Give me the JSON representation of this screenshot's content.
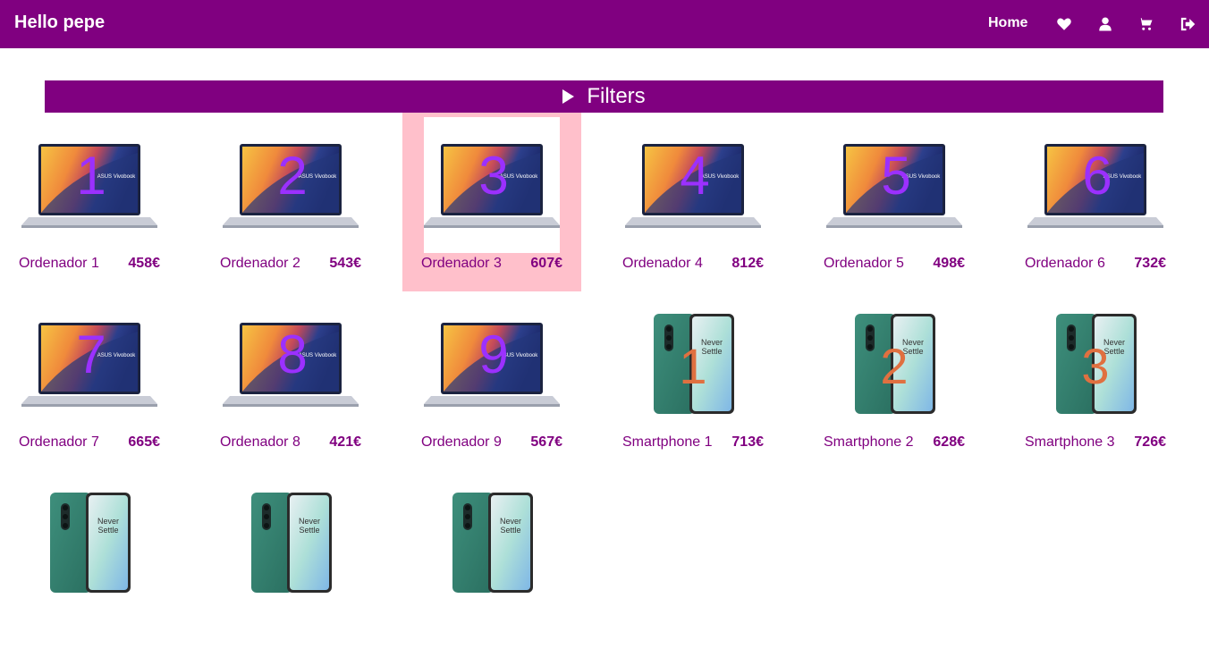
{
  "header": {
    "title": "Hello pepe",
    "home_label": "Home",
    "icons": [
      "heart-icon",
      "user-icon",
      "cart-icon",
      "logout-icon"
    ]
  },
  "filters": {
    "label": "Filters"
  },
  "products": [
    {
      "name": "Ordenador 1",
      "price": "458€",
      "badge": "1",
      "kind": "laptop"
    },
    {
      "name": "Ordenador 2",
      "price": "543€",
      "badge": "2",
      "kind": "laptop"
    },
    {
      "name": "Ordenador 3",
      "price": "607€",
      "badge": "3",
      "kind": "laptop"
    },
    {
      "name": "Ordenador 4",
      "price": "812€",
      "badge": "4",
      "kind": "laptop"
    },
    {
      "name": "Ordenador 5",
      "price": "498€",
      "badge": "5",
      "kind": "laptop"
    },
    {
      "name": "Ordenador 6",
      "price": "732€",
      "badge": "6",
      "kind": "laptop"
    },
    {
      "name": "Ordenador 7",
      "price": "665€",
      "badge": "7",
      "kind": "laptop"
    },
    {
      "name": "Ordenador 8",
      "price": "421€",
      "badge": "8",
      "kind": "laptop"
    },
    {
      "name": "Ordenador 9",
      "price": "567€",
      "badge": "9",
      "kind": "laptop"
    },
    {
      "name": "Smartphone 1",
      "price": "713€",
      "badge": "1",
      "kind": "phone"
    },
    {
      "name": "Smartphone 2",
      "price": "628€",
      "badge": "2",
      "kind": "phone"
    },
    {
      "name": "Smartphone 3",
      "price": "726€",
      "badge": "3",
      "kind": "phone"
    },
    {
      "name": "",
      "price": "",
      "badge": "",
      "kind": "phone"
    },
    {
      "name": "",
      "price": "",
      "badge": "",
      "kind": "phone"
    },
    {
      "name": "",
      "price": "",
      "badge": "",
      "kind": "phone"
    }
  ],
  "laptop_brand_text": "ASUS Vivobook",
  "phone_text": [
    "Never",
    "Settle"
  ],
  "colors": {
    "brand": "#800080",
    "highlight": "#ffc0cb",
    "laptop_badge": "#9b30ff",
    "phone_badge": "#e07040"
  }
}
